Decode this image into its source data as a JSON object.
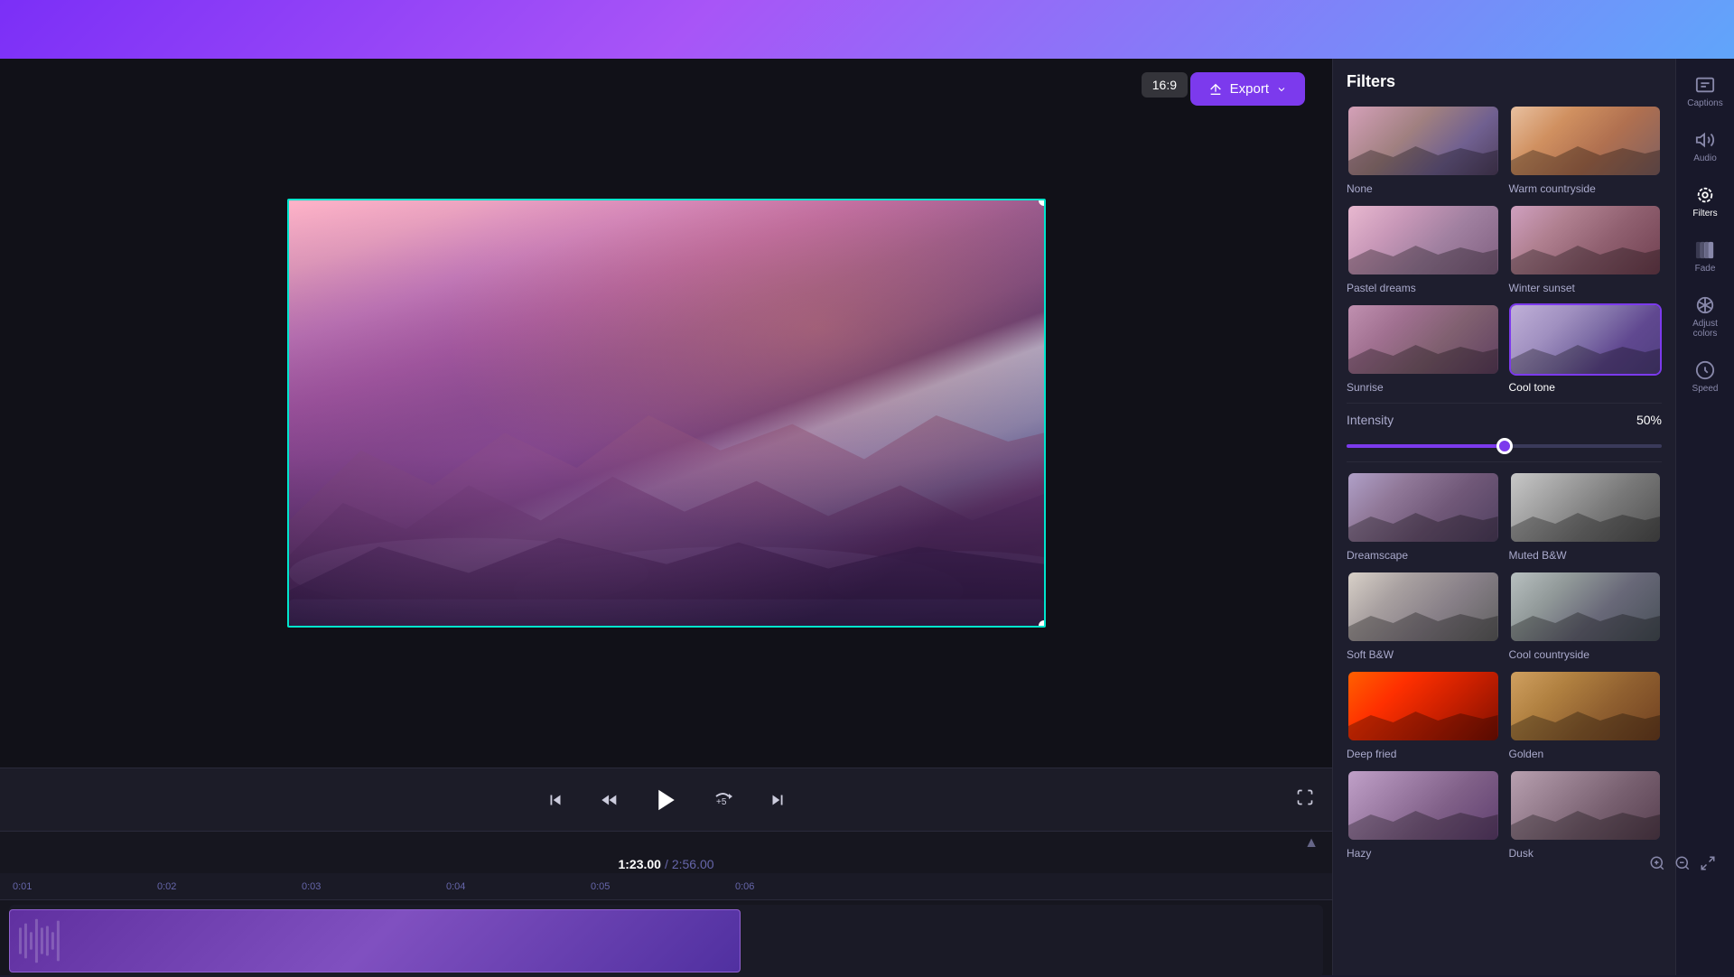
{
  "topBar": {},
  "header": {
    "export_label": "Export",
    "aspect_ratio": "16:9"
  },
  "controls": {
    "time_current": "1:23.00",
    "time_separator": "/",
    "time_total": "2:56.00"
  },
  "timeline": {
    "markers": [
      "0:01",
      "0:02",
      "0:03",
      "0:04",
      "0:05",
      "0:06"
    ]
  },
  "filters": {
    "title": "Filters",
    "intensity_label": "Intensity",
    "intensity_value": "50%",
    "items": [
      {
        "id": "none",
        "name": "None",
        "class": "filter-none",
        "selected": false
      },
      {
        "id": "warm-countryside",
        "name": "Warm countryside",
        "class": "filter-warm-countryside",
        "selected": false
      },
      {
        "id": "pastel-dreams",
        "name": "Pastel dreams",
        "class": "filter-pastel-dreams",
        "selected": false
      },
      {
        "id": "winter-sunset",
        "name": "Winter sunset",
        "class": "filter-winter-sunset",
        "selected": false
      },
      {
        "id": "sunrise",
        "name": "Sunrise",
        "class": "filter-sunrise",
        "selected": false
      },
      {
        "id": "cool-tone",
        "name": "Cool tone",
        "class": "filter-cool-tone",
        "selected": true
      },
      {
        "id": "dreamscape",
        "name": "Dreamscape",
        "class": "filter-dreamscape",
        "selected": false
      },
      {
        "id": "muted-bw",
        "name": "Muted B&W",
        "class": "filter-muted-bw",
        "selected": false
      },
      {
        "id": "soft-bw",
        "name": "Soft B&W",
        "class": "filter-soft-bw",
        "selected": false
      },
      {
        "id": "cool-countryside",
        "name": "Cool countryside",
        "class": "filter-cool-countryside",
        "selected": false
      },
      {
        "id": "deep-fried",
        "name": "Deep fried",
        "class": "filter-deep-fried",
        "selected": false
      },
      {
        "id": "golden",
        "name": "Golden",
        "class": "filter-golden",
        "selected": false
      },
      {
        "id": "extra1",
        "name": "Hazy",
        "class": "filter-extra1",
        "selected": false
      },
      {
        "id": "extra2",
        "name": "Dusk",
        "class": "filter-extra2",
        "selected": false
      }
    ]
  },
  "iconBar": {
    "items": [
      {
        "id": "captions",
        "label": "Captions",
        "icon": "cc"
      },
      {
        "id": "audio",
        "label": "Audio",
        "icon": "audio"
      },
      {
        "id": "filters",
        "label": "Filters",
        "icon": "filters"
      },
      {
        "id": "fade",
        "label": "Fade",
        "icon": "fade"
      },
      {
        "id": "adjust-colors",
        "label": "Adjust colors",
        "icon": "adjust"
      },
      {
        "id": "speed",
        "label": "Speed",
        "icon": "speed"
      }
    ]
  }
}
